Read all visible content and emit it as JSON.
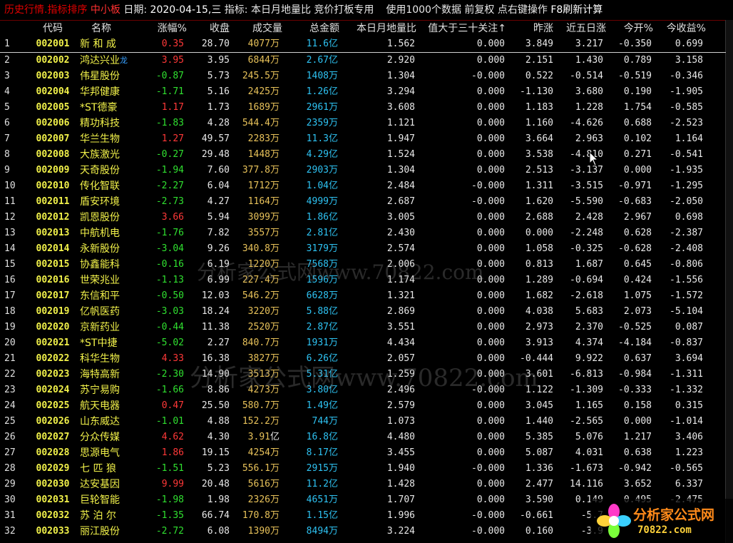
{
  "title_bar": {
    "app": "历史行情.指标排序",
    "board": "中小板",
    "date_label": "日期:",
    "date_value": "2020-04-15,三",
    "indicator_label": "指标:",
    "indicator_value": "本日月地量比 竞价打板专用",
    "data_note": "使用1000个数据",
    "adjust": "前复权",
    "hint": "点右键操作",
    "refresh": "F8刷新计算"
  },
  "headers": {
    "code": "代码",
    "name": "名称",
    "pct": "涨幅%",
    "close": "收盘",
    "volume": "成交量",
    "amount": "总金额",
    "ratio": "本日月地量比",
    "over30": "值大于三十关注",
    "sort_arrow": "↑",
    "prev_pct": "昨涨",
    "five_day": "近五日涨",
    "open_pct": "今开%",
    "gain_pct": "今收益%"
  },
  "units": {
    "wan": "万",
    "yi": "亿"
  },
  "rows": [
    {
      "idx": "1",
      "code": "002001",
      "name": "新 和 成",
      "flag": "",
      "pct": "0.35",
      "dir": "up",
      "close": "28.70",
      "vol": "4077",
      "vol_unit": "万",
      "amt": "11.6",
      "amt_unit": "亿",
      "ratio": "1.562",
      "over30": "0.000",
      "prev": "3.849",
      "five": "3.217",
      "open": "-0.350",
      "gain": "0.699"
    },
    {
      "idx": "2",
      "code": "002002",
      "name": "鸿达兴业",
      "flag": "龙",
      "pct": "3.95",
      "dir": "up",
      "close": "3.95",
      "vol": "6844",
      "vol_unit": "万",
      "amt": "2.67",
      "amt_unit": "亿",
      "ratio": "2.920",
      "over30": "0.000",
      "prev": "2.151",
      "five": "1.430",
      "open": "0.789",
      "gain": "3.158"
    },
    {
      "idx": "3",
      "code": "002003",
      "name": "伟星股份",
      "flag": "",
      "pct": "-0.87",
      "dir": "down",
      "close": "5.73",
      "vol": "245.5",
      "vol_unit": "万",
      "amt": "1408",
      "amt_unit": "万",
      "ratio": "1.304",
      "over30": "-0.000",
      "prev": "0.522",
      "five": "-0.514",
      "open": "-0.519",
      "gain": "-0.346"
    },
    {
      "idx": "4",
      "code": "002004",
      "name": "华邦健康",
      "flag": "",
      "pct": "-1.71",
      "dir": "down",
      "close": "5.16",
      "vol": "2425",
      "vol_unit": "万",
      "amt": "1.26",
      "amt_unit": "亿",
      "ratio": "3.294",
      "over30": "0.000",
      "prev": "-1.130",
      "five": "3.680",
      "open": "0.190",
      "gain": "-1.905"
    },
    {
      "idx": "5",
      "code": "002005",
      "name": "*ST德豪",
      "flag": "",
      "pct": "1.17",
      "dir": "up",
      "close": "1.73",
      "vol": "1689",
      "vol_unit": "万",
      "amt": "2961",
      "amt_unit": "万",
      "ratio": "3.608",
      "over30": "0.000",
      "prev": "1.183",
      "five": "1.228",
      "open": "1.754",
      "gain": "-0.585"
    },
    {
      "idx": "6",
      "code": "002006",
      "name": "精功科技",
      "flag": "",
      "pct": "-1.83",
      "dir": "down",
      "close": "4.28",
      "vol": "544.4",
      "vol_unit": "万",
      "amt": "2359",
      "amt_unit": "万",
      "ratio": "1.121",
      "over30": "0.000",
      "prev": "1.160",
      "five": "-4.626",
      "open": "0.688",
      "gain": "-2.523"
    },
    {
      "idx": "7",
      "code": "002007",
      "name": "华兰生物",
      "flag": "",
      "pct": "1.27",
      "dir": "up",
      "close": "49.57",
      "vol": "2283",
      "vol_unit": "万",
      "amt": "11.3",
      "amt_unit": "亿",
      "ratio": "1.947",
      "over30": "0.000",
      "prev": "3.664",
      "five": "2.963",
      "open": "0.102",
      "gain": "1.164"
    },
    {
      "idx": "8",
      "code": "002008",
      "name": "大族激光",
      "flag": "",
      "pct": "-0.27",
      "dir": "down",
      "close": "29.48",
      "vol": "1448",
      "vol_unit": "万",
      "amt": "4.29",
      "amt_unit": "亿",
      "ratio": "1.524",
      "over30": "0.000",
      "prev": "3.538",
      "five": "-4.810",
      "open": "0.271",
      "gain": "-0.541"
    },
    {
      "idx": "9",
      "code": "002009",
      "name": "天奇股份",
      "flag": "",
      "pct": "-1.94",
      "dir": "down",
      "close": "7.60",
      "vol": "377.8",
      "vol_unit": "万",
      "amt": "2903",
      "amt_unit": "万",
      "ratio": "1.304",
      "over30": "0.000",
      "prev": "2.513",
      "five": "-3.137",
      "open": "0.000",
      "gain": "-1.935"
    },
    {
      "idx": "10",
      "code": "002010",
      "name": "传化智联",
      "flag": "",
      "pct": "-2.27",
      "dir": "down",
      "close": "6.04",
      "vol": "1712",
      "vol_unit": "万",
      "amt": "1.04",
      "amt_unit": "亿",
      "ratio": "2.484",
      "over30": "-0.000",
      "prev": "1.311",
      "five": "-3.515",
      "open": "-0.971",
      "gain": "-1.295"
    },
    {
      "idx": "11",
      "code": "002011",
      "name": "盾安环境",
      "flag": "",
      "pct": "-2.73",
      "dir": "down",
      "close": "4.27",
      "vol": "1164",
      "vol_unit": "万",
      "amt": "4999",
      "amt_unit": "万",
      "ratio": "2.687",
      "over30": "-0.000",
      "prev": "1.620",
      "five": "-5.590",
      "open": "-0.683",
      "gain": "-2.050"
    },
    {
      "idx": "12",
      "code": "002012",
      "name": "凯恩股份",
      "flag": "",
      "pct": "3.66",
      "dir": "up",
      "close": "5.94",
      "vol": "3099",
      "vol_unit": "万",
      "amt": "1.86",
      "amt_unit": "亿",
      "ratio": "3.005",
      "over30": "0.000",
      "prev": "2.688",
      "five": "2.428",
      "open": "2.967",
      "gain": "0.698"
    },
    {
      "idx": "13",
      "code": "002013",
      "name": "中航机电",
      "flag": "",
      "pct": "-1.76",
      "dir": "down",
      "close": "7.82",
      "vol": "3557",
      "vol_unit": "万",
      "amt": "2.81",
      "amt_unit": "亿",
      "ratio": "2.430",
      "over30": "0.000",
      "prev": "0.000",
      "five": "-2.248",
      "open": "0.628",
      "gain": "-2.387"
    },
    {
      "idx": "14",
      "code": "002014",
      "name": "永新股份",
      "flag": "",
      "pct": "-3.04",
      "dir": "down",
      "close": "9.26",
      "vol": "340.8",
      "vol_unit": "万",
      "amt": "3179",
      "amt_unit": "万",
      "ratio": "2.574",
      "over30": "0.000",
      "prev": "1.058",
      "five": "-0.325",
      "open": "-0.628",
      "gain": "-2.408"
    },
    {
      "idx": "15",
      "code": "002015",
      "name": "协鑫能科",
      "flag": "",
      "pct": "-0.16",
      "dir": "down",
      "close": "6.19",
      "vol": "1220",
      "vol_unit": "万",
      "amt": "7568",
      "amt_unit": "万",
      "ratio": "2.006",
      "over30": "0.000",
      "prev": "0.813",
      "five": "1.687",
      "open": "0.645",
      "gain": "-0.806"
    },
    {
      "idx": "16",
      "code": "002016",
      "name": "世荣兆业",
      "flag": "",
      "pct": "-1.13",
      "dir": "down",
      "close": "6.99",
      "vol": "227.4",
      "vol_unit": "万",
      "amt": "1596",
      "amt_unit": "万",
      "ratio": "1.174",
      "over30": "0.000",
      "prev": "1.289",
      "five": "-0.694",
      "open": "0.424",
      "gain": "-1.556"
    },
    {
      "idx": "17",
      "code": "002017",
      "name": "东信和平",
      "flag": "",
      "pct": "-0.50",
      "dir": "down",
      "close": "12.03",
      "vol": "546.2",
      "vol_unit": "万",
      "amt": "6628",
      "amt_unit": "万",
      "ratio": "1.321",
      "over30": "0.000",
      "prev": "1.682",
      "five": "-2.618",
      "open": "1.075",
      "gain": "-1.572"
    },
    {
      "idx": "18",
      "code": "002019",
      "name": "亿帆医药",
      "flag": "",
      "pct": "-3.03",
      "dir": "down",
      "close": "18.24",
      "vol": "3220",
      "vol_unit": "万",
      "amt": "5.88",
      "amt_unit": "亿",
      "ratio": "2.869",
      "over30": "0.000",
      "prev": "4.038",
      "five": "5.683",
      "open": "2.073",
      "gain": "-5.104"
    },
    {
      "idx": "19",
      "code": "002020",
      "name": "京新药业",
      "flag": "",
      "pct": "-0.44",
      "dir": "down",
      "close": "11.38",
      "vol": "2520",
      "vol_unit": "万",
      "amt": "2.87",
      "amt_unit": "亿",
      "ratio": "3.551",
      "over30": "0.000",
      "prev": "2.973",
      "five": "2.370",
      "open": "-0.525",
      "gain": "0.087"
    },
    {
      "idx": "20",
      "code": "002021",
      "name": "*ST中捷",
      "flag": "",
      "pct": "-5.02",
      "dir": "down",
      "close": "2.27",
      "vol": "840.7",
      "vol_unit": "万",
      "amt": "1931",
      "amt_unit": "万",
      "ratio": "4.434",
      "over30": "0.000",
      "prev": "3.913",
      "five": "4.374",
      "open": "-4.184",
      "gain": "-0.837"
    },
    {
      "idx": "21",
      "code": "002022",
      "name": "科华生物",
      "flag": "",
      "pct": "4.33",
      "dir": "up",
      "close": "16.38",
      "vol": "3827",
      "vol_unit": "万",
      "amt": "6.26",
      "amt_unit": "亿",
      "ratio": "2.057",
      "over30": "0.000",
      "prev": "-0.444",
      "five": "9.922",
      "open": "0.637",
      "gain": "3.694"
    },
    {
      "idx": "22",
      "code": "002023",
      "name": "海特高新",
      "flag": "",
      "pct": "-2.30",
      "dir": "down",
      "close": "14.90",
      "vol": "3513",
      "vol_unit": "万",
      "amt": "5.31",
      "amt_unit": "亿",
      "ratio": "1.259",
      "over30": "0.000",
      "prev": "3.601",
      "five": "-6.813",
      "open": "-0.984",
      "gain": "-1.311"
    },
    {
      "idx": "23",
      "code": "002024",
      "name": "苏宁易购",
      "flag": "",
      "pct": "-1.66",
      "dir": "down",
      "close": "8.86",
      "vol": "4273",
      "vol_unit": "万",
      "amt": "3.80",
      "amt_unit": "亿",
      "ratio": "2.496",
      "over30": "-0.000",
      "prev": "1.122",
      "five": "-1.309",
      "open": "-0.333",
      "gain": "-1.332"
    },
    {
      "idx": "24",
      "code": "002025",
      "name": "航天电器",
      "flag": "",
      "pct": "0.47",
      "dir": "up",
      "close": "25.50",
      "vol": "580.7",
      "vol_unit": "万",
      "amt": "1.49",
      "amt_unit": "亿",
      "ratio": "2.579",
      "over30": "0.000",
      "prev": "3.045",
      "five": "1.165",
      "open": "0.158",
      "gain": "0.315"
    },
    {
      "idx": "25",
      "code": "002026",
      "name": "山东威达",
      "flag": "",
      "pct": "-1.01",
      "dir": "down",
      "close": "4.88",
      "vol": "152.2",
      "vol_unit": "万",
      "amt": "744",
      "amt_unit": "万",
      "ratio": "1.073",
      "over30": "0.000",
      "prev": "1.440",
      "five": "-2.565",
      "open": "0.000",
      "gain": "-1.014"
    },
    {
      "idx": "26",
      "code": "002027",
      "name": "分众传媒",
      "flag": "",
      "pct": "4.62",
      "dir": "up",
      "close": "4.30",
      "vol": "3.91",
      "vol_unit": "亿",
      "amt": "16.8",
      "amt_unit": "亿",
      "ratio": "4.480",
      "over30": "0.000",
      "prev": "5.385",
      "five": "5.076",
      "open": "1.217",
      "gain": "3.406"
    },
    {
      "idx": "27",
      "code": "002028",
      "name": "思源电气",
      "flag": "",
      "pct": "1.86",
      "dir": "up",
      "close": "19.15",
      "vol": "4254",
      "vol_unit": "万",
      "amt": "8.17",
      "amt_unit": "亿",
      "ratio": "3.455",
      "over30": "0.000",
      "prev": "5.087",
      "five": "4.031",
      "open": "0.638",
      "gain": "1.223"
    },
    {
      "idx": "28",
      "code": "002029",
      "name": "七 匹 狼",
      "flag": "",
      "pct": "-1.51",
      "dir": "down",
      "close": "5.23",
      "vol": "556.1",
      "vol_unit": "万",
      "amt": "2915",
      "amt_unit": "万",
      "ratio": "1.940",
      "over30": "-0.000",
      "prev": "1.336",
      "five": "-1.673",
      "open": "-0.942",
      "gain": "-0.565"
    },
    {
      "idx": "29",
      "code": "002030",
      "name": "达安基因",
      "flag": "",
      "pct": "9.99",
      "dir": "up",
      "close": "20.48",
      "vol": "5616",
      "vol_unit": "万",
      "amt": "11.2",
      "amt_unit": "亿",
      "ratio": "1.428",
      "over30": "0.000",
      "prev": "2.477",
      "five": "14.116",
      "open": "3.652",
      "gain": "6.337"
    },
    {
      "idx": "30",
      "code": "002031",
      "name": "巨轮智能",
      "flag": "",
      "pct": "-1.98",
      "dir": "down",
      "close": "1.98",
      "vol": "2326",
      "vol_unit": "万",
      "amt": "4651",
      "amt_unit": "万",
      "ratio": "1.707",
      "over30": "0.000",
      "prev": "3.590",
      "five": "0.149",
      "open": "0.495",
      "gain": "-2.475"
    },
    {
      "idx": "31",
      "code": "002032",
      "name": "苏 泊 尔",
      "flag": "",
      "pct": "-1.35",
      "dir": "down",
      "close": "66.74",
      "vol": "170.8",
      "vol_unit": "万",
      "amt": "1.15",
      "amt_unit": "亿",
      "ratio": "1.996",
      "over30": "-0.000",
      "prev": "-0.661",
      "five": "-5.7",
      "open": "",
      "gain": ""
    },
    {
      "idx": "32",
      "code": "002033",
      "name": "丽江股份",
      "flag": "",
      "pct": "-2.72",
      "dir": "down",
      "close": "6.08",
      "vol": "1390",
      "vol_unit": "万",
      "amt": "8494",
      "amt_unit": "万",
      "ratio": "3.224",
      "over30": "-0.000",
      "prev": "0.160",
      "five": "-3.9",
      "open": "",
      "gain": ""
    }
  ],
  "watermark": {
    "text1": "分析家公式网www.70822.com",
    "text2": "分析家公式网www.70822.com"
  },
  "logo": {
    "name": "分析家公式网",
    "url": "70822.com"
  },
  "colors": {
    "up": "#ff3838",
    "down": "#30e030",
    "code": "#f2f24a",
    "volume": "#e8c25a",
    "amount": "#2ec2f2",
    "background": "#000000"
  }
}
